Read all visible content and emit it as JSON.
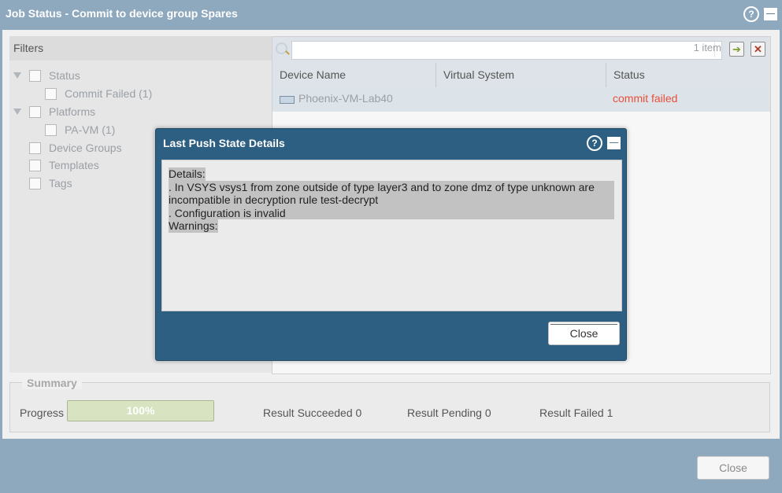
{
  "window": {
    "title": "Job Status - Commit to device group Spares",
    "help_glyph": "?"
  },
  "filters": {
    "header": "Filters",
    "items": [
      {
        "label": "Status"
      },
      {
        "label": "Commit Failed (1)"
      },
      {
        "label": "Platforms"
      },
      {
        "label": "PA-VM (1)"
      },
      {
        "label": "Device Groups"
      },
      {
        "label": "Templates"
      },
      {
        "label": "Tags"
      }
    ]
  },
  "grid": {
    "search_placeholder": "",
    "item_count": "1 item",
    "apply_glyph": "➔",
    "clear_glyph": "✕",
    "columns": [
      "Device Name",
      "Virtual System",
      "Status"
    ],
    "rows": [
      {
        "device_name": "Phoenix-VM-Lab40",
        "virtual_system": "",
        "status": "commit failed"
      }
    ],
    "status_color": "#e8503a"
  },
  "summary": {
    "title": "Summary",
    "progress_label": "Progress",
    "progress_value": "100%",
    "progress_fraction": 1.0,
    "succeeded": "Result Succeeded 0",
    "pending": "Result Pending 0",
    "failed": "Result Failed 1"
  },
  "close_label": "Close",
  "modal": {
    "title": "Last Push State Details",
    "help_glyph": "?",
    "lines": [
      "Details:",
      ". In VSYS vsys1 from zone outside of type layer3 and to zone dmz of type unknown are",
      "incompatible in decryption rule test-decrypt",
      ". Configuration is invalid",
      "Warnings:"
    ],
    "close_label": "Close"
  }
}
